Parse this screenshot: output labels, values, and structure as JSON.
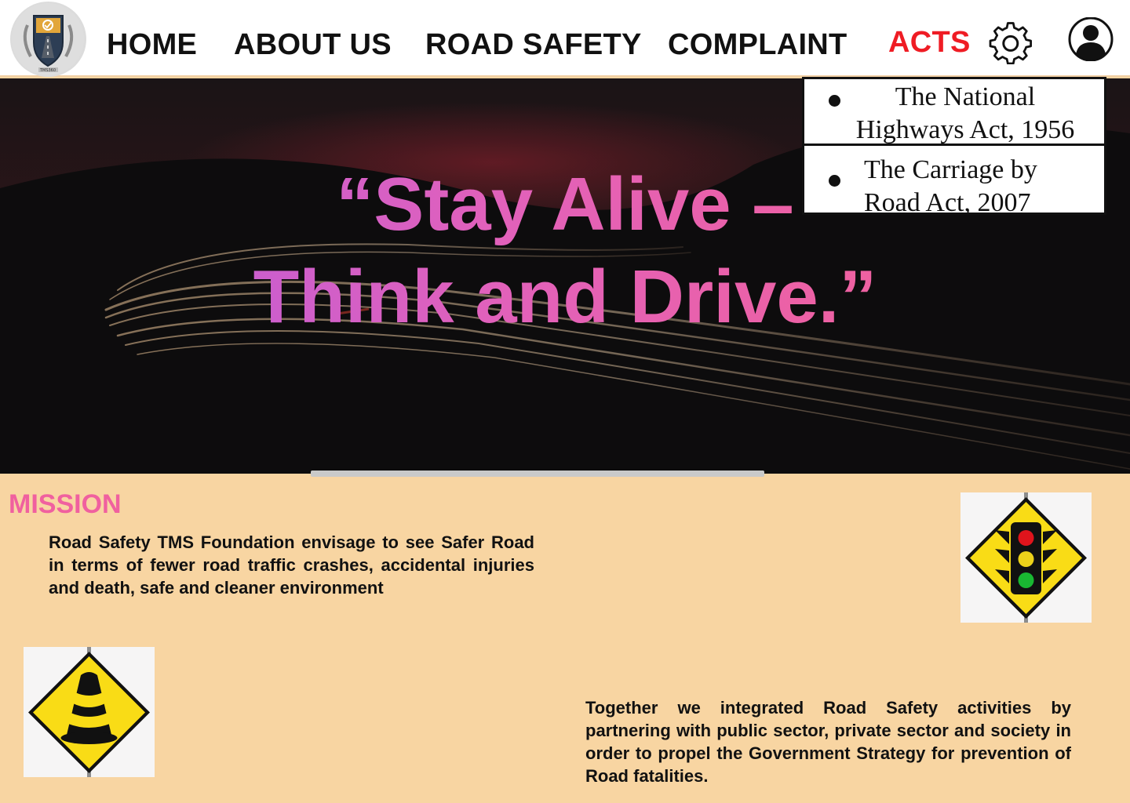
{
  "header": {
    "logo_label": "TMS360",
    "nav": [
      {
        "label": "HOME"
      },
      {
        "label": "ABOUT US"
      },
      {
        "label": "ROAD SAFETY"
      },
      {
        "label": "COMPLAINT"
      },
      {
        "label": "ACTS",
        "active": true
      }
    ],
    "icons": {
      "settings": "gear-icon",
      "profile": "user-avatar-icon"
    }
  },
  "hero": {
    "line1": "“Stay Alive –",
    "line2": "Think and Drive.”"
  },
  "acts_dropdown": {
    "items": [
      {
        "label": "The National Highways Act, 1956"
      },
      {
        "label": "The Carriage by Road Act, 2007"
      }
    ]
  },
  "mission": {
    "title": "MISSION",
    "text": "Road Safety TMS Foundation envisage to see Safer Road in terms of fewer road traffic crashes, accidental injuries and death, safe and cleaner environment",
    "together": "Together we integrated Road Safety activities by partnering with public sector, private sector and society in order to propel the Government Strategy for prevention of Road fatalities."
  },
  "signs": {
    "traffic": "traffic-light-sign-icon",
    "cone": "traffic-cone-sign-icon"
  },
  "colors": {
    "accent_red": "#ef1c24",
    "mission_pink": "#f0609f",
    "background_peach": "#f8d5a2",
    "gradient_start": "#b55be0",
    "gradient_end": "#f7618f"
  }
}
